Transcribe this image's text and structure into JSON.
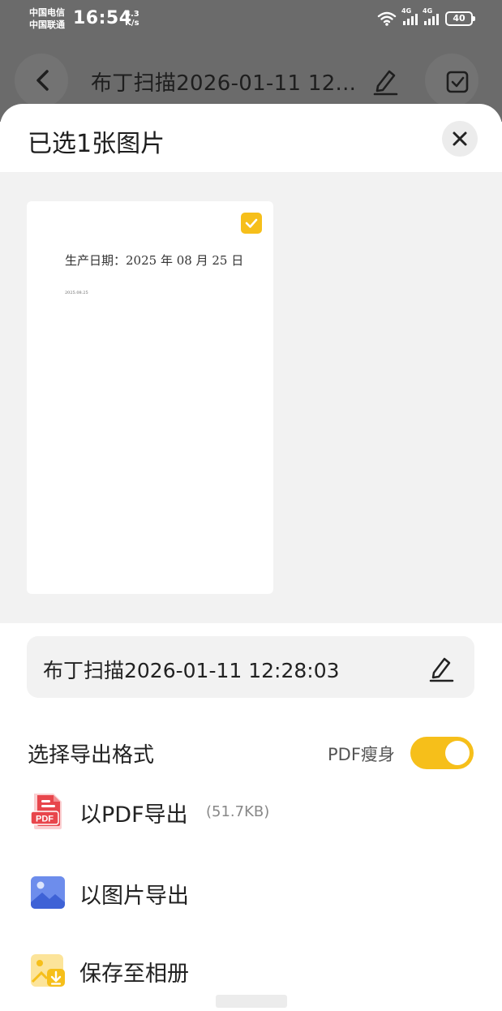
{
  "status_bar": {
    "carrier_1": "中国电信",
    "carrier_2": "中国联通",
    "time": "16:54",
    "net_speed_value": "4.3",
    "net_speed_unit": "K/s",
    "sim1_tag": "4G",
    "sim2_tag": "4G",
    "battery": "40"
  },
  "header": {
    "title": "布丁扫描2026-01-11 12..."
  },
  "sheet": {
    "title": "已选1张图片",
    "page_text_main": "生产日期：2025 年 08 月 25 日",
    "page_text_small": "2025.08.25",
    "page_selected": true,
    "file_name": "布丁扫描2026-01-11 12:28:03",
    "format_label": "选择导出格式",
    "pdf_slim_label": "PDF瘦身",
    "pdf_slim_on": true,
    "options": [
      {
        "label": "以PDF导出",
        "size": "(51.7KB)",
        "icon": "pdf-file-icon"
      },
      {
        "label": "以图片导出",
        "icon": "image-icon"
      },
      {
        "label": "保存至相册",
        "icon": "save-to-album-icon"
      }
    ]
  },
  "colors": {
    "accent": "#f6bf1a",
    "pdf_red": "#e8464c",
    "image_blue": "#5b7fe8",
    "backdrop": "#6b6b6b"
  }
}
